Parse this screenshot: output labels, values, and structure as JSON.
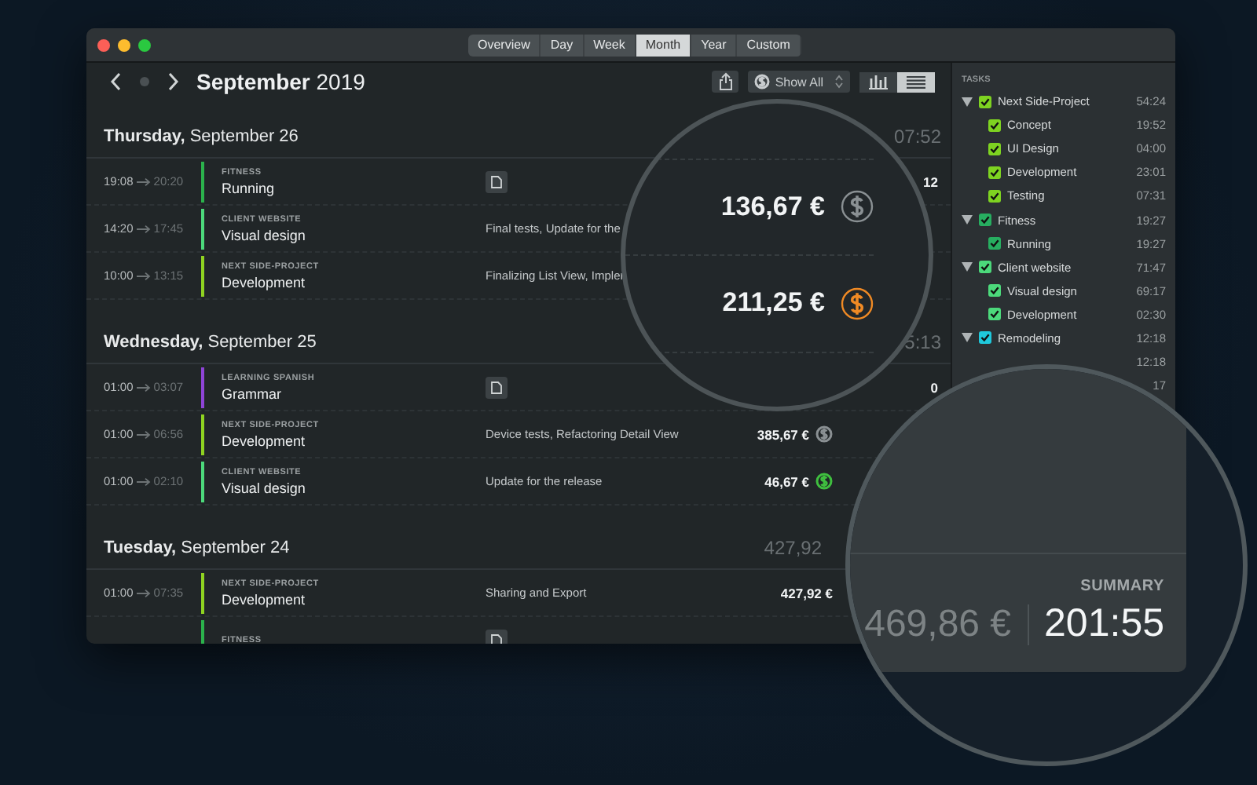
{
  "tabs": [
    {
      "label": "Overview",
      "selected": false
    },
    {
      "label": "Day",
      "selected": false
    },
    {
      "label": "Week",
      "selected": false
    },
    {
      "label": "Month",
      "selected": true
    },
    {
      "label": "Year",
      "selected": false
    },
    {
      "label": "Custom",
      "selected": false
    }
  ],
  "header": {
    "title": "**September** 2019",
    "filter": "Show All",
    "views": [
      {
        "kind": "chart",
        "selected": false
      },
      {
        "kind": "list",
        "selected": true
      }
    ]
  },
  "days": [
    {
      "weekday": "Thursday,",
      "date": "September 26",
      "total": "07:52",
      "entries": [
        {
          "start": "19:08",
          "end": "20:20",
          "category": "FITNESS",
          "title": "Running",
          "color": "#2bb24c",
          "note": true,
          "trailing": "12"
        },
        {
          "start": "14:20",
          "end": "17:45",
          "category": "CLIENT WEBSITE",
          "title": "Visual design",
          "color": "#4cd97b",
          "note": false,
          "description": "Final tests, Update for the"
        },
        {
          "start": "10:00",
          "end": "13:15",
          "category": "NEXT SIDE-PROJECT",
          "title": "Development",
          "color": "#8fd321",
          "note": false,
          "description": "Finalizing List View, Impler"
        }
      ]
    },
    {
      "weekday": "Wednesday,",
      "date": "September 25",
      "total": "5:13",
      "entries": [
        {
          "start": "01:00",
          "end": "03:07",
          "category": "LEARNING SPANISH",
          "title": "Grammar",
          "color": "#8e44d6",
          "note": true,
          "trailing": "0"
        },
        {
          "start": "01:00",
          "end": "06:56",
          "category": "NEXT SIDE-PROJECT",
          "title": "Development",
          "color": "#8fd321",
          "note": false,
          "description": "Device tests, Refactoring Detail View",
          "amount": "385,67 €",
          "dollar": {
            "color": "#8a9093"
          }
        },
        {
          "start": "01:00",
          "end": "02:10",
          "category": "CLIENT WEBSITE",
          "title": "Visual design",
          "color": "#4cd97b",
          "note": false,
          "description": "Update for the release",
          "amount": "46,67 €",
          "dollar": {
            "color": "#3fbf3f"
          }
        }
      ]
    },
    {
      "weekday": "Tuesday,",
      "date": "September 24",
      "total": "427,92",
      "entries": [
        {
          "start": "01:00",
          "end": "07:35",
          "category": "NEXT SIDE-PROJECT",
          "title": "Development",
          "color": "#8fd321",
          "note": false,
          "description": "Sharing and Export",
          "amount": "427,92 €"
        },
        {
          "category": "FITNESS",
          "color": "#2bb24c",
          "note": true
        }
      ]
    }
  ],
  "sidebar": {
    "heading": "TASKS",
    "tasks": [
      {
        "label": "Next Side-Project",
        "time": "54:24",
        "checked": true,
        "expanded": true,
        "color": "#7ed321",
        "children": [
          {
            "label": "Concept",
            "time": "19:52",
            "checked": true,
            "color": "#7ed321"
          },
          {
            "label": "UI Design",
            "time": "04:00",
            "checked": true,
            "color": "#7ed321"
          },
          {
            "label": "Development",
            "time": "23:01",
            "checked": true,
            "color": "#7ed321"
          },
          {
            "label": "Testing",
            "time": "07:31",
            "checked": true,
            "color": "#7ed321"
          }
        ]
      },
      {
        "label": "Fitness",
        "time": "19:27",
        "checked": true,
        "expanded": true,
        "color": "#27ae60",
        "children": [
          {
            "label": "Running",
            "time": "19:27",
            "checked": true,
            "color": "#27ae60"
          }
        ]
      },
      {
        "label": "Client website",
        "time": "71:47",
        "checked": true,
        "expanded": true,
        "color": "#4cd97b",
        "children": [
          {
            "label": "Visual design",
            "time": "69:17",
            "checked": true,
            "color": "#4cd97b"
          },
          {
            "label": "Development",
            "time": "02:30",
            "checked": true,
            "color": "#4cd97b"
          }
        ]
      },
      {
        "label": "Remodeling",
        "time": "12:18",
        "checked": true,
        "expanded": true,
        "color": "#1fc8db",
        "children": [
          {
            "time": "12:18"
          },
          {
            "time": "17"
          }
        ]
      }
    ]
  },
  "magnifiers": [
    {
      "kind": "amounts",
      "amounts": [
        {
          "value": "136,67 €",
          "color": "#8a9093"
        },
        {
          "value": "211,25 €",
          "color": "#f08a24"
        }
      ]
    },
    {
      "kind": "summary",
      "label": "SUMMARY",
      "amount": "469,86 €",
      "time": "201:55"
    }
  ]
}
